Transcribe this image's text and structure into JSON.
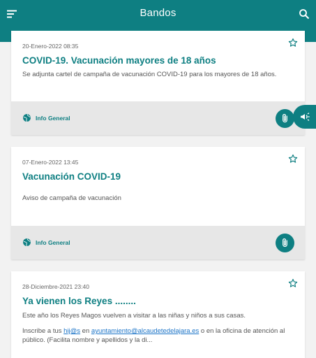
{
  "appbar": {
    "title": "Bandos",
    "menu_icon": "menu-icon",
    "search_icon": "search-icon"
  },
  "colors": {
    "primary": "#0e7f82",
    "footer_bg": "#e7e7e7",
    "link": "#1a73c7"
  },
  "cards": [
    {
      "date": "20-Enero-2022 08:35",
      "title": "COVID-19. Vacunación mayores de 18 años",
      "description": "Se adjunta cartel de campaña de vacunación COVID-19 para los mayores de 18 años.",
      "category": "Info General"
    },
    {
      "date": "07-Enero-2022 13:45",
      "title": "Vacunación COVID-19",
      "description": "Aviso de campaña de vacunación",
      "category": "Info General"
    },
    {
      "date": "28-Diciembre-2021 23:40",
      "title": "Ya vienen los Reyes ........",
      "description": "Este año los Reyes Magos vuelven a visitar a las niñas y niños a sus casas.",
      "description2_prefix": "Inscribe a tus ",
      "description2_link1": "hij@s",
      "description2_middle": " en ",
      "description2_link2": "ayuntamiento@alcaudetedelajara.es",
      "description2_suffix": " o en la oficina de atención al público. (Facilita nombre y apellidos y la di..."
    }
  ],
  "icons": {
    "star": "star-outline-icon",
    "globe": "globe-icon",
    "attach": "paperclip-icon",
    "fab": "megaphone-icon"
  }
}
